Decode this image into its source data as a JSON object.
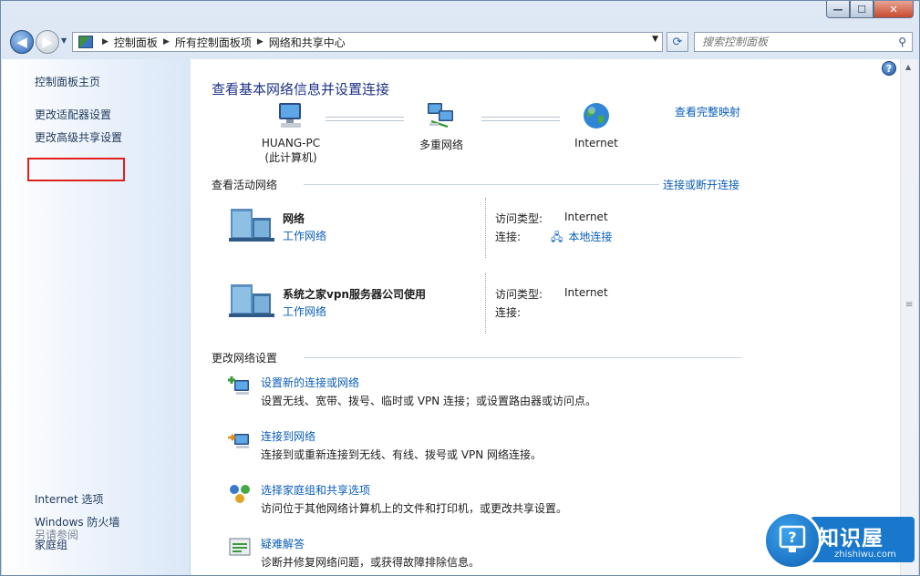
{
  "window": {
    "controls": {
      "minimize": "—",
      "maximize": "☐",
      "close": "✕"
    }
  },
  "navbar": {
    "back_icon": "◀",
    "forward_icon": "▶",
    "breadcrumb": [
      "控制面板",
      "所有控制面板项",
      "网络和共享中心"
    ],
    "separator": "▶",
    "search_placeholder": "搜索控制面板"
  },
  "leftpane": {
    "items": [
      {
        "label": "控制面板主页"
      },
      {
        "label": "更改适配器设置",
        "highlighted": true
      },
      {
        "label": "更改高级共享设置"
      }
    ],
    "see_also_heading": "另请参阅",
    "see_also": [
      "Internet 选项",
      "Windows 防火墙",
      "家庭组"
    ],
    "highlight_color": "#e0201d"
  },
  "main": {
    "title": "查看基本网络信息并设置连接",
    "full_map_link": "查看完整映射",
    "map": {
      "pc_name": "HUANG-PC",
      "pc_sub": "(此计算机)",
      "middle": "多重网络",
      "right": "Internet"
    },
    "active_heading": "查看活动网络",
    "connect_link": "连接或断开连接",
    "networks": [
      {
        "name": "网络",
        "type": "工作网络",
        "access_label": "访问类型:",
        "access_value": "Internet",
        "conn_label": "连接:",
        "conn_value": "本地连接"
      },
      {
        "name": "系统之家vpn服务器公司使用",
        "type": "工作网络",
        "access_label": "访问类型:",
        "access_value": "Internet",
        "conn_label": "连接:",
        "conn_value": ""
      }
    ],
    "change_heading": "更改网络设置",
    "tasks": [
      {
        "title": "设置新的连接或网络",
        "desc": "设置无线、宽带、拨号、临时或 VPN 连接；或设置路由器或访问点。"
      },
      {
        "title": "连接到网络",
        "desc": "连接到或重新连接到无线、有线、拨号或 VPN 网络连接。"
      },
      {
        "title": "选择家庭组和共享选项",
        "desc": "访问位于其他网络计算机上的文件和打印机，或更改共享设置。"
      },
      {
        "title": "疑难解答",
        "desc": "诊断并修复网络问题，或获得故障排除信息。"
      }
    ]
  },
  "watermark": {
    "title": "知识屋",
    "sub": "zhishiwu.com"
  },
  "colors": {
    "link": "#0a5db8",
    "title": "#1e3287"
  }
}
